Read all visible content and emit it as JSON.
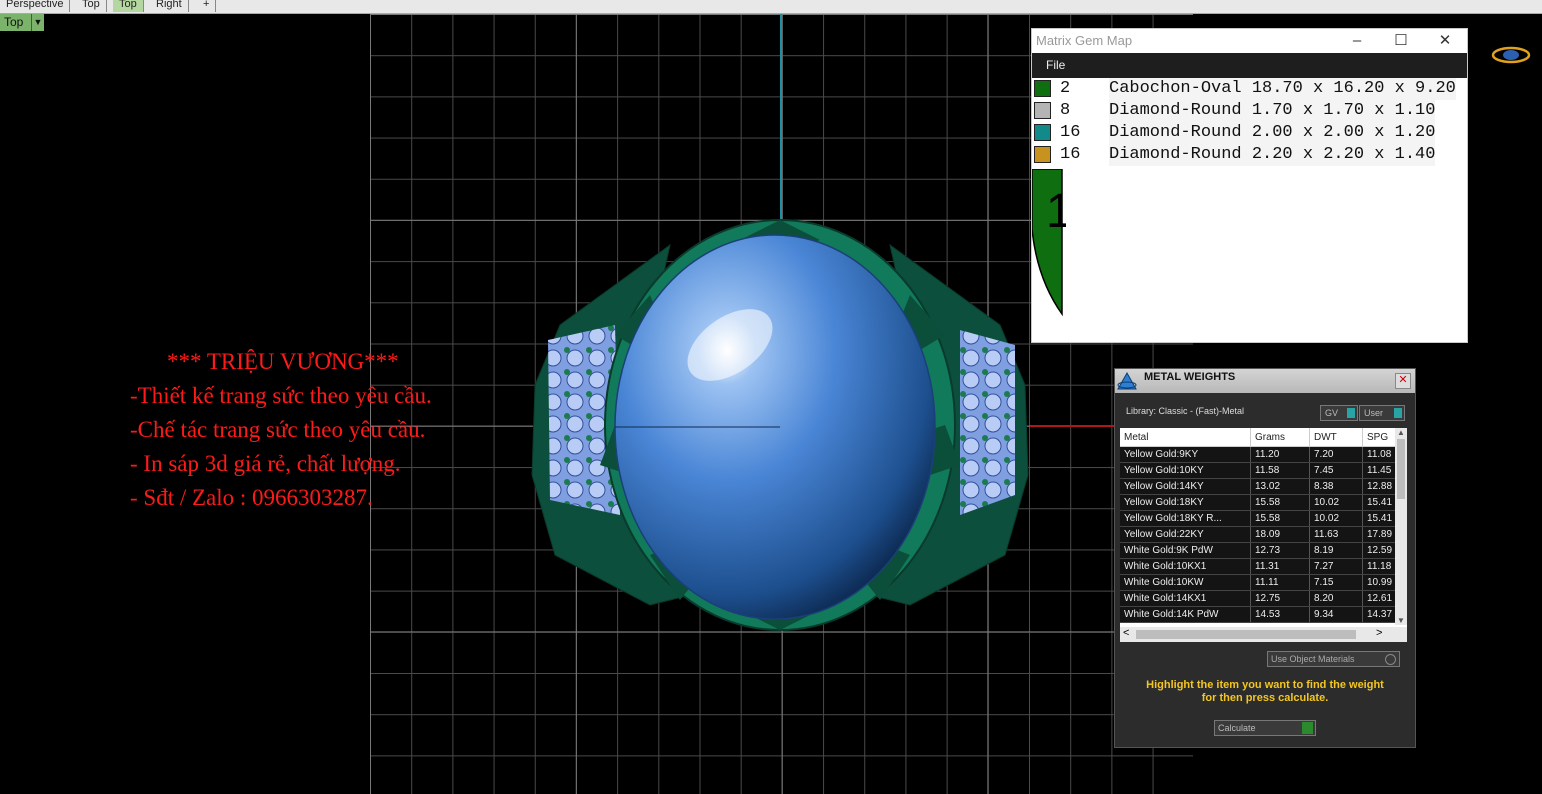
{
  "viewport_tabs": [
    "Perspective",
    "Top",
    "Top",
    "Right",
    "+"
  ],
  "viewport_label": "Top",
  "promo": {
    "line1": "*** TRIỆU VƯƠNG***",
    "line2": "-Thiết kế trang sức theo yêu cầu.",
    "line3": "-Chế tác trang sức theo yêu cầu.",
    "line4": "- In sáp 3d giá rẻ, chất lượng.",
    "line5": "- Sđt / Zalo : 0966303287."
  },
  "gem_map": {
    "title": "Matrix Gem Map",
    "menu_file": "File",
    "rows": [
      {
        "count": "2",
        "desc": "Cabochon-Oval 18.70 x 16.20 x 9.20",
        "color": "#0f6e0f"
      },
      {
        "count": "8",
        "desc": "Diamond-Round 1.70 x 1.70 x 1.10",
        "color": "#b4b4b4"
      },
      {
        "count": "16",
        "desc": "Diamond-Round 2.00 x 2.00 x 1.20",
        "color": "#138a8a"
      },
      {
        "count": "16",
        "desc": "Diamond-Round 2.20 x 2.20 x 1.40",
        "color": "#c8921e"
      }
    ],
    "big_label": "1"
  },
  "metal_weights": {
    "title": "METAL WEIGHTS",
    "library": "Library: Classic - (Fast)-Metal",
    "gv_button": "GV",
    "user_button": "User",
    "columns": [
      "Metal",
      "Grams",
      "DWT",
      "SPG"
    ],
    "rows": [
      [
        "Yellow Gold:9KY",
        "11.20",
        "7.20",
        "11.08"
      ],
      [
        "Yellow Gold:10KY",
        "11.58",
        "7.45",
        "11.45"
      ],
      [
        "Yellow Gold:14KY",
        "13.02",
        "8.38",
        "12.88"
      ],
      [
        "Yellow Gold:18KY",
        "15.58",
        "10.02",
        "15.41"
      ],
      [
        "Yellow Gold:18KY R...",
        "15.58",
        "10.02",
        "15.41"
      ],
      [
        "Yellow Gold:22KY",
        "18.09",
        "11.63",
        "17.89"
      ],
      [
        "White Gold:9K PdW",
        "12.73",
        "8.19",
        "12.59"
      ],
      [
        "White Gold:10KX1",
        "11.31",
        "7.27",
        "11.18"
      ],
      [
        "White Gold:10KW",
        "11.11",
        "7.15",
        "10.99"
      ],
      [
        "White Gold:14KX1",
        "12.75",
        "8.20",
        "12.61"
      ],
      [
        "White Gold:14K PdW",
        "14.53",
        "9.34",
        "14.37"
      ]
    ],
    "use_object_materials": "Use Object Materials",
    "hint_line1": "Highlight the item you want to find the weight",
    "hint_line2": "for then press calculate.",
    "calculate": "Calculate"
  },
  "colors": {
    "gem": "#4a86d6",
    "ring_metal": "#117a5a",
    "promo_text": "#ff1a1a"
  }
}
